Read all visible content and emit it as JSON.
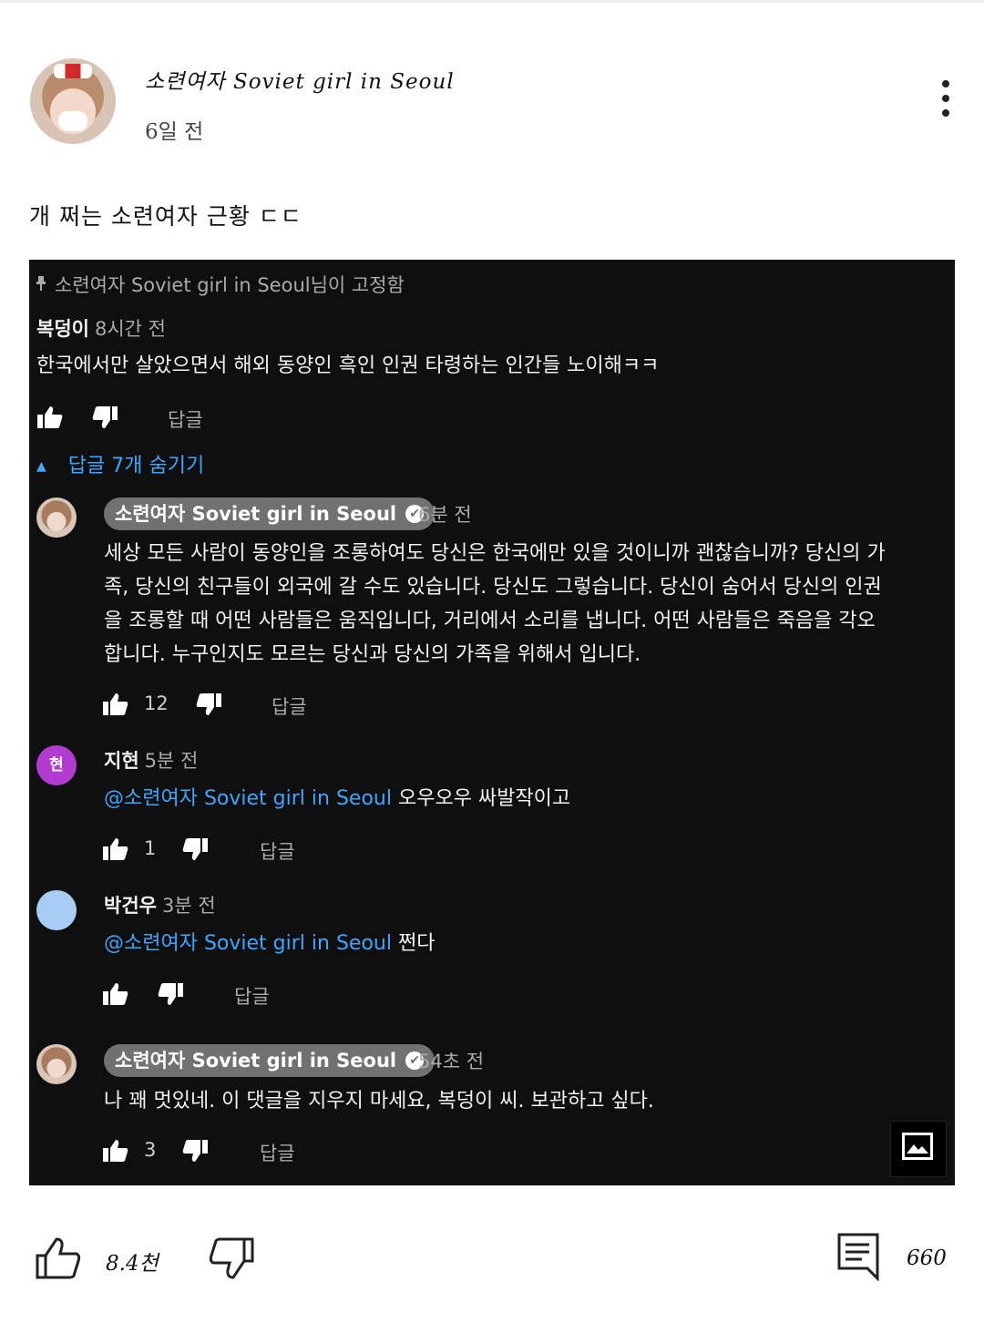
{
  "post": {
    "author": "소련여자 Soviet girl in Seoul",
    "time": "6일 전",
    "text": "개 쩌는 소련여자 근황 ㄷㄷ"
  },
  "screenshot": {
    "pinned_by": "소련여자 Soviet girl in Seoul님이 고정함",
    "top_comment": {
      "name": "복덩이",
      "time": "8시간 전",
      "text": "한국에서만 살았으면서 해외 동양인 흑인 인권 타령하는 인간들 노이해ㅋㅋ",
      "reply_label": "답글"
    },
    "toggle_replies": "답글 7개 숨기기",
    "replies": [
      {
        "name": "소련여자 Soviet girl in Seoul",
        "time": "6분 전",
        "text_lines": [
          "세상 모든 사람이 동양인을 조롱하여도 당신은 한국에만 있을 것이니까 괜찮습니까? 당신의 가",
          "족, 당신의 친구들이 외국에 갈 수도 있습니다. 당신도 그렇습니다. 당신이 숨어서 당신의 인권",
          "을 조롱할 때 어떤 사람들은 움직입니다, 거리에서 소리를 냅니다. 어떤 사람들은 죽음을 각오",
          "합니다. 누구인지도 모르는 당신과 당신의 가족을 위해서 입니다."
        ],
        "likes": "12",
        "reply_label": "답글"
      },
      {
        "name": "지현",
        "avatar_letter": "현",
        "time": "5분 전",
        "mention": "@소련여자 Soviet girl in Seoul",
        "text": "오우오우 싸발작이고",
        "likes": "1",
        "reply_label": "답글"
      },
      {
        "name": "박건우",
        "time": "3분 전",
        "mention": "@소련여자 Soviet girl in Seoul",
        "text": "쩐다",
        "reply_label": "답글"
      },
      {
        "name": "소련여자 Soviet girl in Seoul",
        "time": "54초 전",
        "text": "나 꽤 멋있네. 이 댓글을 지우지 마세요, 복덩이 씨. 보관하고 싶다.",
        "likes": "3",
        "reply_label": "답글"
      }
    ]
  },
  "footer": {
    "like_count": "8.4천",
    "comment_count": "660"
  },
  "colors": {
    "dark_bg": "#0f0f0f",
    "link_blue": "#3ea6ff",
    "chip_gray": "#717171",
    "hyun_avatar": "#b23bd1",
    "blue_avatar": "#a7cdf5"
  },
  "icons": [
    "kebab-menu-icon",
    "pin-icon",
    "thumbs-up-icon",
    "thumbs-down-icon",
    "caret-up-icon",
    "verified-check-icon",
    "image-icon",
    "comment-icon"
  ]
}
